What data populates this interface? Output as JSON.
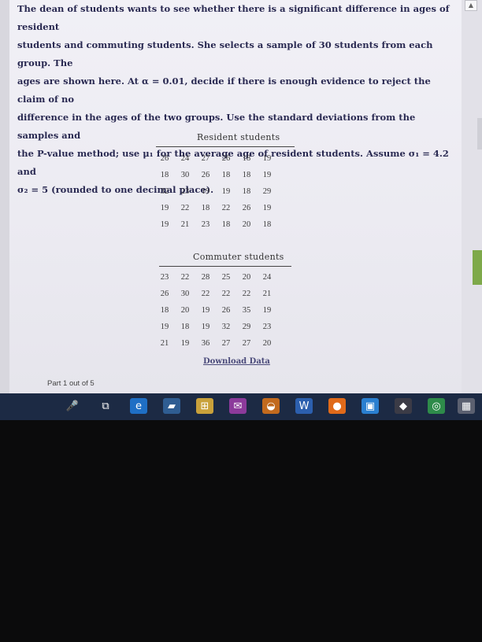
{
  "problem": {
    "lines": [
      "The dean of students wants to see whether there is a significant difference in ages of resident",
      "students and commuting students. She selects a sample of 30 students from each group. The",
      "ages are shown here. At α = 0.01, decide if there is enough evidence to reject the claim of no",
      "difference in the ages of the two groups. Use the standard deviations from the samples and",
      "the P-value method; use μ₁ for the average age of resident students. Assume σ₁ = 4.2 and",
      "σ₂ = 5 (rounded to one decimal place)."
    ]
  },
  "resident": {
    "title": "Resident students",
    "rows": [
      [
        "26",
        "24",
        "27",
        "26",
        "18",
        "19"
      ],
      [
        "18",
        "30",
        "26",
        "18",
        "18",
        "19"
      ],
      [
        "32",
        "23",
        "19",
        "19",
        "18",
        "29"
      ],
      [
        "19",
        "22",
        "18",
        "22",
        "26",
        "19"
      ],
      [
        "19",
        "21",
        "23",
        "18",
        "20",
        "18"
      ]
    ]
  },
  "commuter": {
    "title": "Commuter students",
    "rows": [
      [
        "23",
        "22",
        "28",
        "25",
        "20",
        "24"
      ],
      [
        "26",
        "30",
        "22",
        "22",
        "22",
        "21"
      ],
      [
        "18",
        "20",
        "19",
        "26",
        "35",
        "19"
      ],
      [
        "19",
        "18",
        "19",
        "32",
        "29",
        "23"
      ],
      [
        "21",
        "19",
        "36",
        "27",
        "27",
        "20"
      ]
    ]
  },
  "download_label": "Download Data",
  "part_label": "Part 1 out of 5",
  "taskbar": {
    "icons": [
      {
        "name": "microphone-icon",
        "glyph": "🎤",
        "color": "#1c2a44"
      },
      {
        "name": "task-view-icon",
        "glyph": "⧉",
        "color": "#1c2a44"
      },
      {
        "name": "edge-icon",
        "glyph": "e",
        "color": "#1f6fc5"
      },
      {
        "name": "file-explorer-icon",
        "glyph": "▰",
        "color": "#2f5d92"
      },
      {
        "name": "store-icon",
        "glyph": "⊞",
        "color": "#c9a13b"
      },
      {
        "name": "mail-icon",
        "glyph": "✉",
        "color": "#8c3a9b"
      },
      {
        "name": "onenote-icon",
        "glyph": "◒",
        "color": "#c26a1e"
      },
      {
        "name": "word-icon",
        "glyph": "W",
        "color": "#2c5fae"
      },
      {
        "name": "firefox-icon",
        "glyph": "●",
        "color": "#e06a1a"
      },
      {
        "name": "photos-icon",
        "glyph": "▣",
        "color": "#2a7fd0"
      },
      {
        "name": "media-icon",
        "glyph": "◆",
        "color": "#3b3b46"
      },
      {
        "name": "chrome-icon",
        "glyph": "◎",
        "color": "#2e8b4a"
      },
      {
        "name": "calculator-icon",
        "glyph": "▦",
        "color": "#5b6070"
      }
    ]
  }
}
